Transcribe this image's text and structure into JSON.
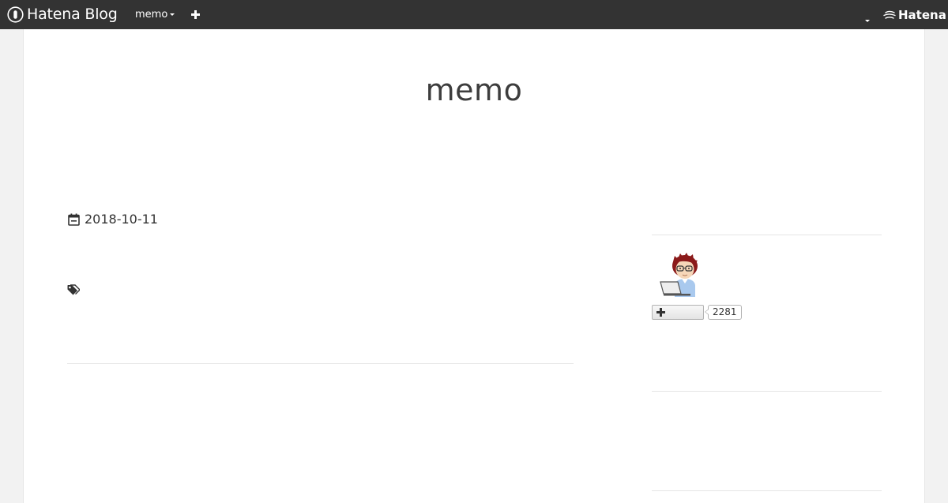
{
  "header": {
    "brand": "Hatena Blog",
    "blog_menu_label": "memo",
    "add_icon": "plus-icon",
    "hatena_brand": "Hatena",
    "background_color": "#333333"
  },
  "blog": {
    "title": "memo"
  },
  "entry": {
    "date": "2018-10-11",
    "date_icon": "calendar-icon",
    "tag_icon": "tag-icon"
  },
  "sidebar": {
    "profile": {
      "avatar_icon": "avatar-illustration-man-with-laptop",
      "subscribe_icon": "plus-icon",
      "subscriber_count": "2281"
    }
  }
}
